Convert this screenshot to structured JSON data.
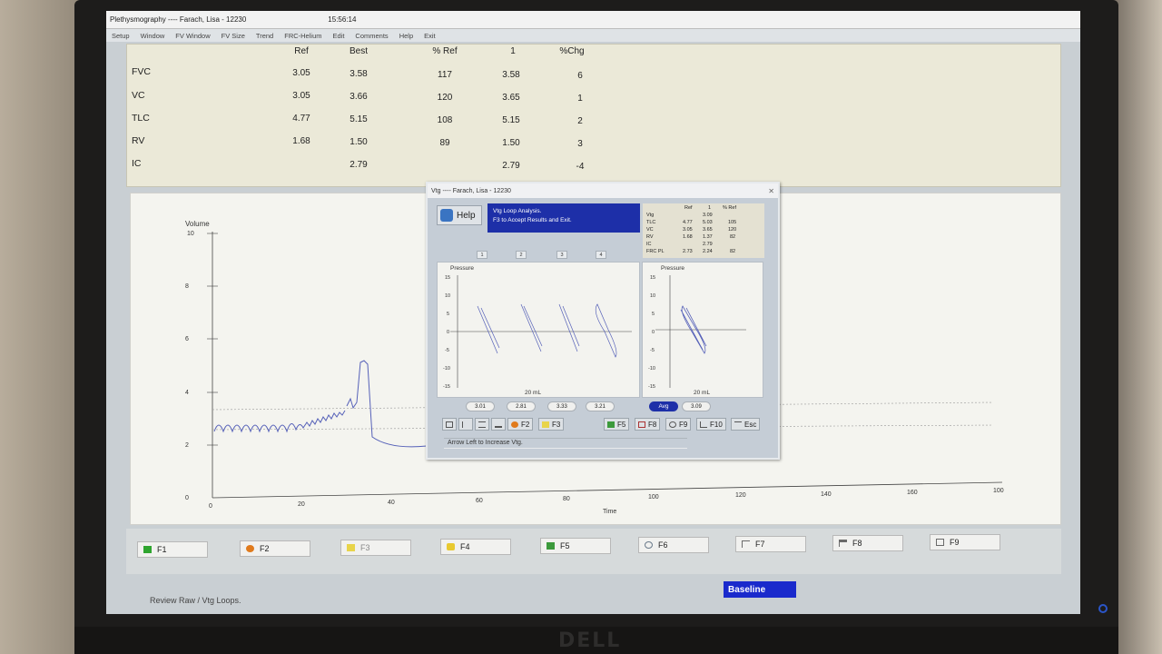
{
  "app": {
    "window_title": "Plethysmography ---- Farach, Lisa - 12230",
    "time": "15:56:14",
    "menu": [
      "Setup",
      "Window",
      "FV Window",
      "FV Size",
      "Trend",
      "FRC-Helium",
      "Edit",
      "Comments",
      "Help",
      "Exit"
    ]
  },
  "results_table": {
    "headers": [
      "Ref",
      "Best",
      "% Ref",
      "1",
      "%Chg"
    ],
    "rows": [
      {
        "label": "FVC",
        "ref": "3.05",
        "best": "3.58",
        "pct_ref": "117",
        "trial1": "3.58",
        "pct_chg": "6"
      },
      {
        "label": "VC",
        "ref": "3.05",
        "best": "3.66",
        "pct_ref": "120",
        "trial1": "3.65",
        "pct_chg": "1"
      },
      {
        "label": "TLC",
        "ref": "4.77",
        "best": "5.15",
        "pct_ref": "108",
        "trial1": "5.15",
        "pct_chg": "2"
      },
      {
        "label": "RV",
        "ref": "1.68",
        "best": "1.50",
        "pct_ref": "89",
        "trial1": "1.50",
        "pct_chg": "3"
      },
      {
        "label": "IC",
        "ref": "",
        "best": "2.79",
        "pct_ref": "",
        "trial1": "2.79",
        "pct_chg": "-4"
      }
    ]
  },
  "volume_chart": {
    "ylabel": "Volume",
    "xlabel": "Time",
    "y_ticks": [
      "10",
      "8",
      "6",
      "4",
      "2",
      "0"
    ],
    "x_ticks": [
      "0",
      "20",
      "40",
      "60",
      "80",
      "100",
      "120",
      "140",
      "160",
      "100"
    ]
  },
  "fkeys": [
    {
      "label": "F1",
      "icon": "green-square-icon",
      "color": "#2fa52f"
    },
    {
      "label": "F2",
      "icon": "orange-circle-icon",
      "color": "#e07a1c"
    },
    {
      "label": "F3",
      "icon": "yellow-folder-icon",
      "color": "#e8d44a",
      "disabled": true
    },
    {
      "label": "F4",
      "icon": "yellow-note-icon",
      "color": "#e8c930"
    },
    {
      "label": "F5",
      "icon": "green-printer-icon",
      "color": "#3c9a3c"
    },
    {
      "label": "F6",
      "icon": "magnifier-icon",
      "color": "#6a7a8a"
    },
    {
      "label": "F7",
      "icon": "cursor-icon",
      "color": "#6a6a6a"
    },
    {
      "label": "F8",
      "icon": "flag-icon",
      "color": "#6a6a6a"
    },
    {
      "label": "F9",
      "icon": "document-icon",
      "color": "#6a6a6a"
    }
  ],
  "status_text": "Review Raw / Vtg Loops.",
  "mode_badge": "Baseline",
  "dialog": {
    "title": "Vtg ---- Farach, Lisa - 12230",
    "help_label": "Help",
    "instruction_line1": "Vtg Loop Analysis.",
    "instruction_line2": "F3 to Accept Results and Exit.",
    "summary_headers": [
      "Ref",
      "1",
      "% Ref"
    ],
    "summary_rows": [
      {
        "label": "Vtg",
        "ref": "",
        "trial1": "3.09",
        "pct": ""
      },
      {
        "label": "TLC",
        "ref": "4.77",
        "trial1": "5.03",
        "pct": "105"
      },
      {
        "label": "VC",
        "ref": "3.05",
        "trial1": "3.65",
        "pct": "120"
      },
      {
        "label": "RV",
        "ref": "1.68",
        "trial1": "1.37",
        "pct": "82"
      },
      {
        "label": "IC",
        "ref": "",
        "trial1": "2.79",
        "pct": ""
      },
      {
        "label": "FRC PL",
        "ref": "2.73",
        "trial1": "2.24",
        "pct": "82"
      }
    ],
    "loop_tabs": [
      "1",
      "2",
      "3",
      "4"
    ],
    "left_plot": {
      "ylabel": "Pressure",
      "xlabel": "20 mL",
      "y_ticks": [
        "15",
        "10",
        "5",
        "0",
        "-5",
        "-10",
        "-15"
      ]
    },
    "right_plot": {
      "ylabel": "Pressure",
      "xlabel": "20 mL",
      "y_ticks": [
        "15",
        "10",
        "5",
        "0",
        "-5",
        "-10",
        "-15"
      ]
    },
    "vtg_values": [
      "3.01",
      "2.81",
      "3.33",
      "3.21"
    ],
    "avg_label": "Avg",
    "avg_value": "3.09",
    "toolbar": {
      "f2": "F2",
      "f3": "F3",
      "f5": "F5",
      "f8": "F8",
      "f9": "F9",
      "f10": "F10",
      "esc": "Esc"
    },
    "status": "Arrow Left to Increase Vtg."
  }
}
